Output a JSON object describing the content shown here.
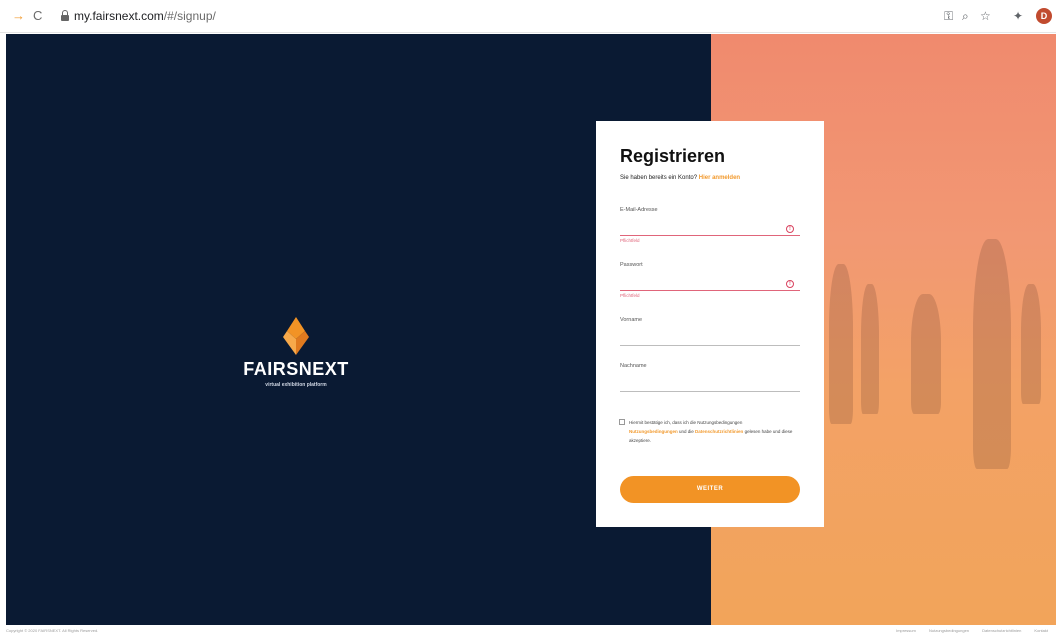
{
  "browser": {
    "url_host": "my.fairsnext.com",
    "url_path": "/#/signup/",
    "avatar_letter": "D"
  },
  "brand": {
    "name": "FAIRSNEXT",
    "tagline": "virtual exhibition platform",
    "accent": "#f29325",
    "navy": "#0a1a33"
  },
  "form": {
    "title": "Registrieren",
    "subtitle_text": "Sie haben bereits ein Konto?",
    "subtitle_link": "Hier anmelden",
    "email_label": "E-Mail-Adresse",
    "email_error": "Pflichtfeld",
    "password_label": "Passwort",
    "password_error": "Pflichtfeld",
    "firstname_label": "Vorname",
    "lastname_label": "Nachname",
    "consent_part1": "Hiermit bestätige ich, dass ich die Nutzungsbedingungen",
    "consent_link1": "Nutzungsbedingungen",
    "consent_part2": "und die",
    "consent_link2": "Datenschutzrichtlinien",
    "consent_part3": "gelesen habe und diese akzeptiere.",
    "submit_label": "WEITER"
  },
  "footer": {
    "copyright": "Copyright © 2020 FAIRSNEXT. All Rights Reserved.",
    "links": [
      "Impressum",
      "Nutzungsbedingungen",
      "Datenschutzrichtlinien",
      "Kontakt"
    ]
  }
}
